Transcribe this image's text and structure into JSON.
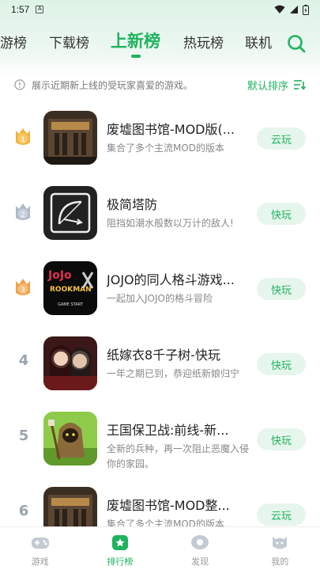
{
  "status_bar": {
    "time": "1:57",
    "notification_badge": "A"
  },
  "tabs": [
    {
      "label": "游榜"
    },
    {
      "label": "下载榜"
    },
    {
      "label": "上新榜",
      "active": true
    },
    {
      "label": "热玩榜"
    },
    {
      "label": "联机"
    }
  ],
  "info": {
    "text": "展示近期新上线的受玩家喜爱的游戏。",
    "sort_label": "默认排序"
  },
  "games": [
    {
      "rank": "1",
      "medal": "gold",
      "title": "废墟图书馆-MOD版(...",
      "desc": "集合了多个主流MOD的版本",
      "action": "云玩"
    },
    {
      "rank": "2",
      "medal": "silver",
      "title": "极简塔防",
      "desc": "阻挡如潮水般数以万计的敌人!",
      "action": "快玩"
    },
    {
      "rank": "3",
      "medal": "bronze",
      "title": "JOJO的同人格斗游戏...",
      "desc": "一起加入JOJO的格斗冒险",
      "action": "快玩"
    },
    {
      "rank": "4",
      "medal": "",
      "title": "纸嫁衣8千子树-快玩",
      "desc": "一年之期已到，恭迎纸新娘归宁",
      "action": "快玩"
    },
    {
      "rank": "5",
      "medal": "",
      "title": "王国保卫战:前线-新...",
      "desc": "全新的兵种，再一次阻止恶魔入侵你的家园。",
      "action": "快玩"
    },
    {
      "rank": "6",
      "medal": "",
      "title": "废墟图书馆-MOD整...",
      "desc": "集合了多个主流MOD的版本",
      "action": "云玩"
    }
  ],
  "thumb_text": {
    "jojo_top": "JoJo",
    "jojo_sub": "ROOKMAN",
    "jojo_start": "GAME START"
  },
  "bottom_nav": [
    {
      "label": "游戏",
      "icon": "gamepad-icon"
    },
    {
      "label": "排行榜",
      "icon": "ranking-icon",
      "active": true
    },
    {
      "label": "发现",
      "icon": "discover-icon"
    },
    {
      "label": "我的",
      "icon": "profile-icon"
    }
  ],
  "colors": {
    "accent": "#1fb35e",
    "accent_light": "#e6f6ec",
    "gold": "#f2b33d",
    "silver": "#aeb8c8",
    "bronze": "#f0a24a"
  }
}
